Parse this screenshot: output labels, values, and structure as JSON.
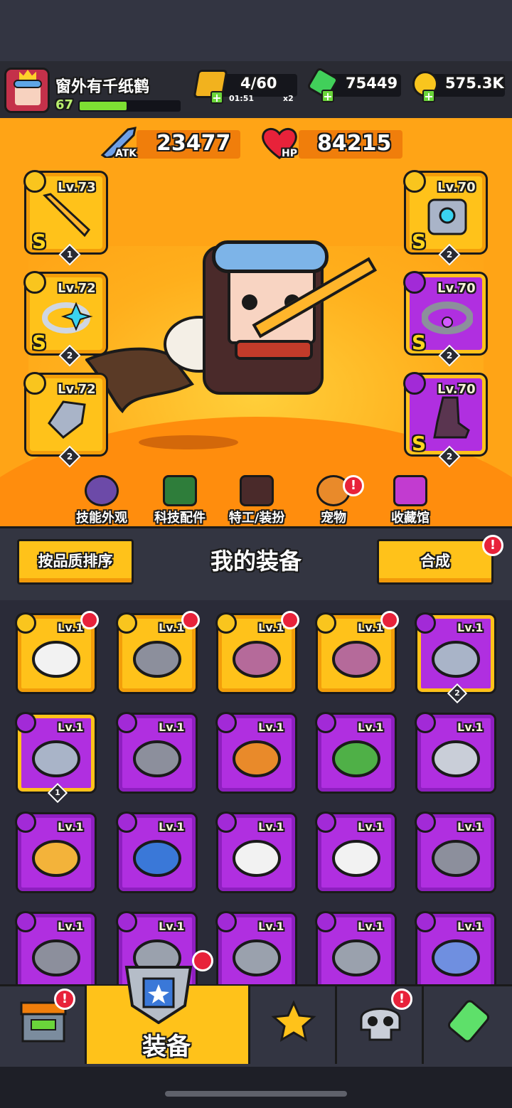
{
  "player": {
    "name": "窗外有千纸鹤",
    "level": "67",
    "level_progress": 0.47
  },
  "resources": {
    "energy": {
      "value": "4/60",
      "timer": "01:51",
      "multiplier": "x2"
    },
    "gems": "75449",
    "coins": "575.3K"
  },
  "stats": {
    "atk_value": "23477",
    "atk_label": "ATK",
    "hp_value": "84215",
    "hp_label": "HP"
  },
  "equipped": {
    "left": [
      {
        "level": "Lv.73",
        "grade": "S",
        "stars": "1",
        "item": "sword-icon",
        "type": "weapon-icon"
      },
      {
        "level": "Lv.72",
        "grade": "S",
        "stars": "2",
        "item": "ring-icon",
        "type": "ring-type-icon"
      },
      {
        "level": "Lv.72",
        "grade": "S",
        "stars": "2",
        "item": "gauntlet-icon",
        "type": "glove-type-icon"
      }
    ],
    "right": [
      {
        "level": "Lv.70",
        "grade": "S",
        "stars": "2",
        "item": "armor-icon",
        "type": "armor-type-icon"
      },
      {
        "level": "Lv.70",
        "grade": "S",
        "stars": "2",
        "item": "belt-icon",
        "type": "belt-type-icon"
      },
      {
        "level": "Lv.70",
        "grade": "S",
        "stars": "2",
        "item": "boots-icon",
        "type": "boots-type-icon"
      }
    ]
  },
  "menu": [
    {
      "label": "技能外观",
      "icon": "skill-skin-icon"
    },
    {
      "label": "科技配件",
      "icon": "tech-part-icon"
    },
    {
      "label": "特工/装扮",
      "icon": "agent-icon"
    },
    {
      "label": "宠物",
      "icon": "pet-icon",
      "alert": "!"
    },
    {
      "label": "收藏馆",
      "icon": "collection-icon"
    }
  ],
  "panel": {
    "sort_button": "按品质排序",
    "title": "我的装备",
    "merge_button": "合成",
    "merge_alert": "!"
  },
  "inventory": {
    "level_text": "Lv.1",
    "rows": [
      [
        {
          "rarity": "gold",
          "item": "skull-belt-icon",
          "badge": true
        },
        {
          "rarity": "gold",
          "item": "belt-icon",
          "badge": true
        },
        {
          "rarity": "gold",
          "item": "boots-icon",
          "badge": true
        },
        {
          "rarity": "gold",
          "item": "boots-icon",
          "badge": true
        },
        {
          "rarity": "purple",
          "item": "kunai-icon",
          "stars": "2",
          "selected": true
        }
      ],
      [
        {
          "rarity": "purple",
          "item": "kunai-icon",
          "stars": "1",
          "selected": true
        },
        {
          "rarity": "purple",
          "item": "revolver-icon"
        },
        {
          "rarity": "purple",
          "item": "torch-icon"
        },
        {
          "rarity": "purple",
          "item": "leaf-armor-icon"
        },
        {
          "rarity": "purple",
          "item": "ring-icon"
        }
      ],
      [
        {
          "rarity": "purple",
          "item": "lantern-necklace-icon"
        },
        {
          "rarity": "purple",
          "item": "shield-necklace-icon"
        },
        {
          "rarity": "purple",
          "item": "skull-belt-icon"
        },
        {
          "rarity": "purple",
          "item": "skull-belt-icon"
        },
        {
          "rarity": "purple",
          "item": "belt-icon"
        }
      ],
      [
        {
          "rarity": "purple",
          "item": "belt-icon"
        },
        {
          "rarity": "purple",
          "item": "gem-belt-icon"
        },
        {
          "rarity": "purple",
          "item": "gem-belt-icon"
        },
        {
          "rarity": "purple",
          "item": "gem-belt-icon"
        },
        {
          "rarity": "purple",
          "item": "fur-glove-icon"
        }
      ]
    ]
  },
  "bottom_nav": {
    "tabs": [
      {
        "icon": "shop-icon",
        "alert": "!"
      },
      {
        "icon": "equipment-icon",
        "label": "装备",
        "active": true
      },
      {
        "icon": "talent-star-icon"
      },
      {
        "icon": "skull-icon",
        "alert": "!"
      },
      {
        "icon": "evolve-tube-icon"
      }
    ]
  },
  "colors": {
    "stage_orange": "#ffa416",
    "gold_frame": "#ffc21a",
    "purple_frame": "#b02fe0",
    "alert_red": "#e8223a"
  }
}
